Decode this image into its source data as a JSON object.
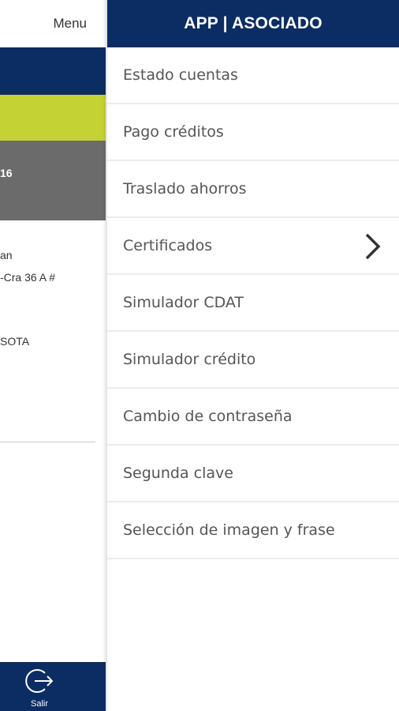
{
  "left_panel": {
    "menu_label": "Menu",
    "gray_text": "16",
    "lines": [
      "an",
      "-Cra 36 A #",
      "SOTA"
    ],
    "exit_label": "Salir"
  },
  "drawer": {
    "title": "APP | ASOCIADO",
    "items": [
      {
        "label": "Estado cuentas"
      },
      {
        "label": "Pago créditos"
      },
      {
        "label": "Traslado ahorros"
      },
      {
        "label": "Certificados",
        "icon": "chevron-right-icon"
      },
      {
        "label": "Simulador CDAT"
      },
      {
        "label": "Simulador crédito"
      },
      {
        "label": "Cambio de contraseña"
      },
      {
        "label": "Segunda clave"
      },
      {
        "label": "Selección de imagen y frase"
      }
    ]
  },
  "colors": {
    "navy": "#0c2d63",
    "lime": "#c5d233",
    "gray": "#6b6b6b"
  }
}
